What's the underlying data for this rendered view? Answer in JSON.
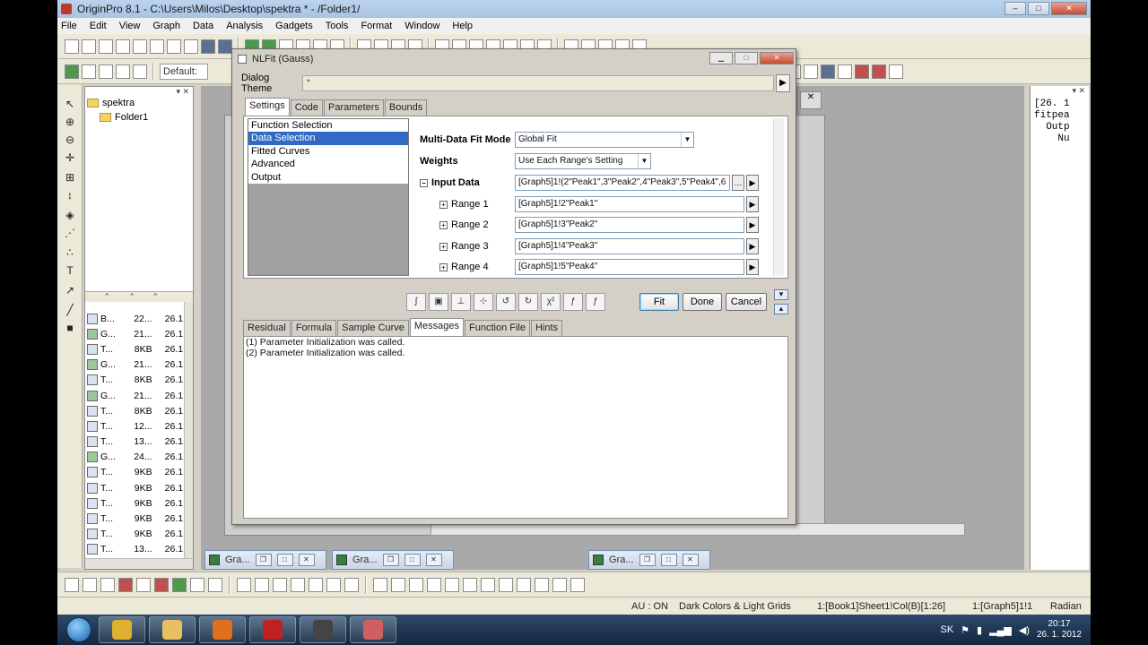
{
  "window": {
    "title": "OriginPro 8.1 - C:\\Users\\Milos\\Desktop\\spektra * - /Folder1/",
    "buttons": {
      "min": "–",
      "max": "□",
      "close": "✕"
    }
  },
  "menu": [
    "File",
    "Edit",
    "View",
    "Graph",
    "Data",
    "Analysis",
    "Gadgets",
    "Tools",
    "Format",
    "Window",
    "Help"
  ],
  "toolbar2": {
    "default_label": "Default:"
  },
  "project_explorer": {
    "root": "spektra",
    "folder": "Folder1",
    "files": [
      {
        "type": "t",
        "name": "B...",
        "size": "22...",
        "date": "26.1."
      },
      {
        "type": "g",
        "name": "G...",
        "size": "21...",
        "date": "26.1."
      },
      {
        "type": "t",
        "name": "T...",
        "size": "8KB",
        "date": "26.1."
      },
      {
        "type": "g",
        "name": "G...",
        "size": "21...",
        "date": "26.1."
      },
      {
        "type": "t",
        "name": "T...",
        "size": "8KB",
        "date": "26.1."
      },
      {
        "type": "g",
        "name": "G...",
        "size": "21...",
        "date": "26.1."
      },
      {
        "type": "t",
        "name": "T...",
        "size": "8KB",
        "date": "26.1."
      },
      {
        "type": "t",
        "name": "T...",
        "size": "12...",
        "date": "26.1."
      },
      {
        "type": "t",
        "name": "T...",
        "size": "13...",
        "date": "26.1."
      },
      {
        "type": "g",
        "name": "G...",
        "size": "24...",
        "date": "26.1."
      },
      {
        "type": "t",
        "name": "T...",
        "size": "9KB",
        "date": "26.1."
      },
      {
        "type": "t",
        "name": "T...",
        "size": "9KB",
        "date": "26.1."
      },
      {
        "type": "t",
        "name": "T...",
        "size": "9KB",
        "date": "26.1."
      },
      {
        "type": "t",
        "name": "T...",
        "size": "9KB",
        "date": "26.1."
      },
      {
        "type": "t",
        "name": "T...",
        "size": "9KB",
        "date": "26.1."
      },
      {
        "type": "t",
        "name": "T...",
        "size": "13...",
        "date": "26.1."
      }
    ]
  },
  "results_window": {
    "text": "[26. 1\nfitpea\n  Outp\n    Nu"
  },
  "minimized": [
    {
      "label": "Gra..."
    },
    {
      "label": "Gra..."
    },
    {
      "label": "Gra..."
    }
  ],
  "statusbar": {
    "au": "AU : ON",
    "theme": "Dark Colors & Light Grids",
    "cell": "1:[Book1]Sheet1!Col(B)[1:26]",
    "layer": "1:[Graph5]1!1",
    "units": "Radian"
  },
  "taskbar": {
    "lang": "SK",
    "time": "20:17",
    "date": "26. 1. 2012",
    "apps": [
      {
        "name": "chrome-icon",
        "color": "#e0b030"
      },
      {
        "name": "explorer-icon",
        "color": "#e8c060"
      },
      {
        "name": "media-player-icon",
        "color": "#e07020"
      },
      {
        "name": "acrobat-icon",
        "color": "#c02020"
      },
      {
        "name": "video-app-icon",
        "color": "#444444"
      },
      {
        "name": "origin-app-icon",
        "color": "#d06060"
      }
    ]
  },
  "dialog": {
    "title": "NLFit (Gauss)",
    "theme_label": "Dialog Theme",
    "theme_value": "*",
    "top_tabs": [
      "Settings",
      "Code",
      "Parameters",
      "Bounds"
    ],
    "nav_items": [
      "Function Selection",
      "Data Selection",
      "Fitted Curves",
      "Advanced",
      "Output"
    ],
    "props": {
      "fit_mode_label": "Multi-Data Fit Mode",
      "fit_mode_value": "Global Fit",
      "weights_label": "Weights",
      "weights_value": "Use Each Range's Setting",
      "input_label": "Input Data",
      "input_value": "[Graph5]1!(2\"Peak1\",3\"Peak2\",4\"Peak3\",5\"Peak4\",6",
      "ranges": [
        {
          "label": "Range 1",
          "value": "[Graph5]1!2\"Peak1\""
        },
        {
          "label": "Range 2",
          "value": "[Graph5]1!3\"Peak2\""
        },
        {
          "label": "Range 3",
          "value": "[Graph5]1!4\"Peak3\""
        },
        {
          "label": "Range 4",
          "value": "[Graph5]1!5\"Peak4\""
        }
      ]
    },
    "buttons": {
      "fit": "Fit",
      "done": "Done",
      "cancel": "Cancel"
    },
    "bottom_tabs": [
      "Residual",
      "Formula",
      "Sample Curve",
      "Messages",
      "Function File",
      "Hints"
    ],
    "messages": [
      "(1) Parameter Initialization was called.",
      "(2) Parameter Initialization was called."
    ]
  }
}
